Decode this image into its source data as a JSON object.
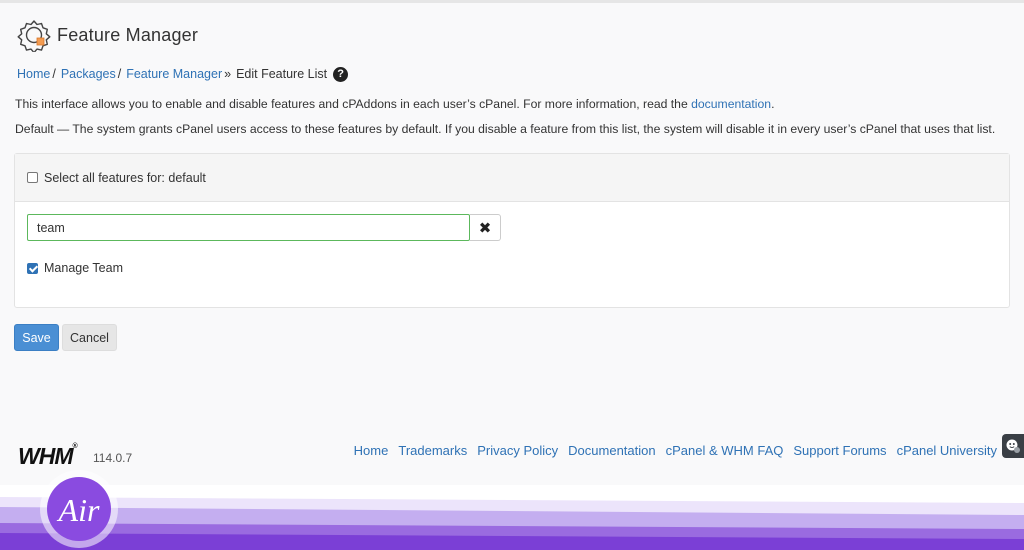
{
  "header": {
    "title": "Feature Manager",
    "icon": "gear-box-icon"
  },
  "breadcrumb": {
    "items": [
      "Home",
      "Packages",
      "Feature Manager"
    ],
    "separators": [
      "/",
      "/",
      "»"
    ],
    "current": "Edit Feature List",
    "help_glyph": "?"
  },
  "description": {
    "line1_text": "This interface allows you to enable and disable features and cPAddons in each user’s cPanel. For more information, read the ",
    "line1_link": "documentation",
    "line1_end": ".",
    "line2": "Default — The system grants cPanel users access to these features by default. If you disable a feature from this list, the system will disable it in every user’s cPanel that uses that list."
  },
  "panel": {
    "select_all_label": "Select all features for: default",
    "select_all_checked": false,
    "search_value": "team",
    "clear_glyph": "✖",
    "features": [
      {
        "label": "Manage Team",
        "checked": true
      }
    ]
  },
  "actions": {
    "save_label": "Save",
    "cancel_label": "Cancel"
  },
  "footer": {
    "logo_text": "WHM",
    "logo_mark": "®",
    "version": "114.0.7",
    "links": [
      "Home",
      "Trademarks",
      "Privacy Policy",
      "Documentation",
      "cPanel & WHM FAQ",
      "Support Forums",
      "cPanel University"
    ]
  },
  "branding": {
    "overlay_logo_text": "Air",
    "colors": {
      "accent": "#2f72b5",
      "save_button": "#4a8fd4",
      "search_border": "#5cb85c",
      "purple_dark": "#7b3fd6",
      "purple_light": "#c4aef0"
    }
  }
}
